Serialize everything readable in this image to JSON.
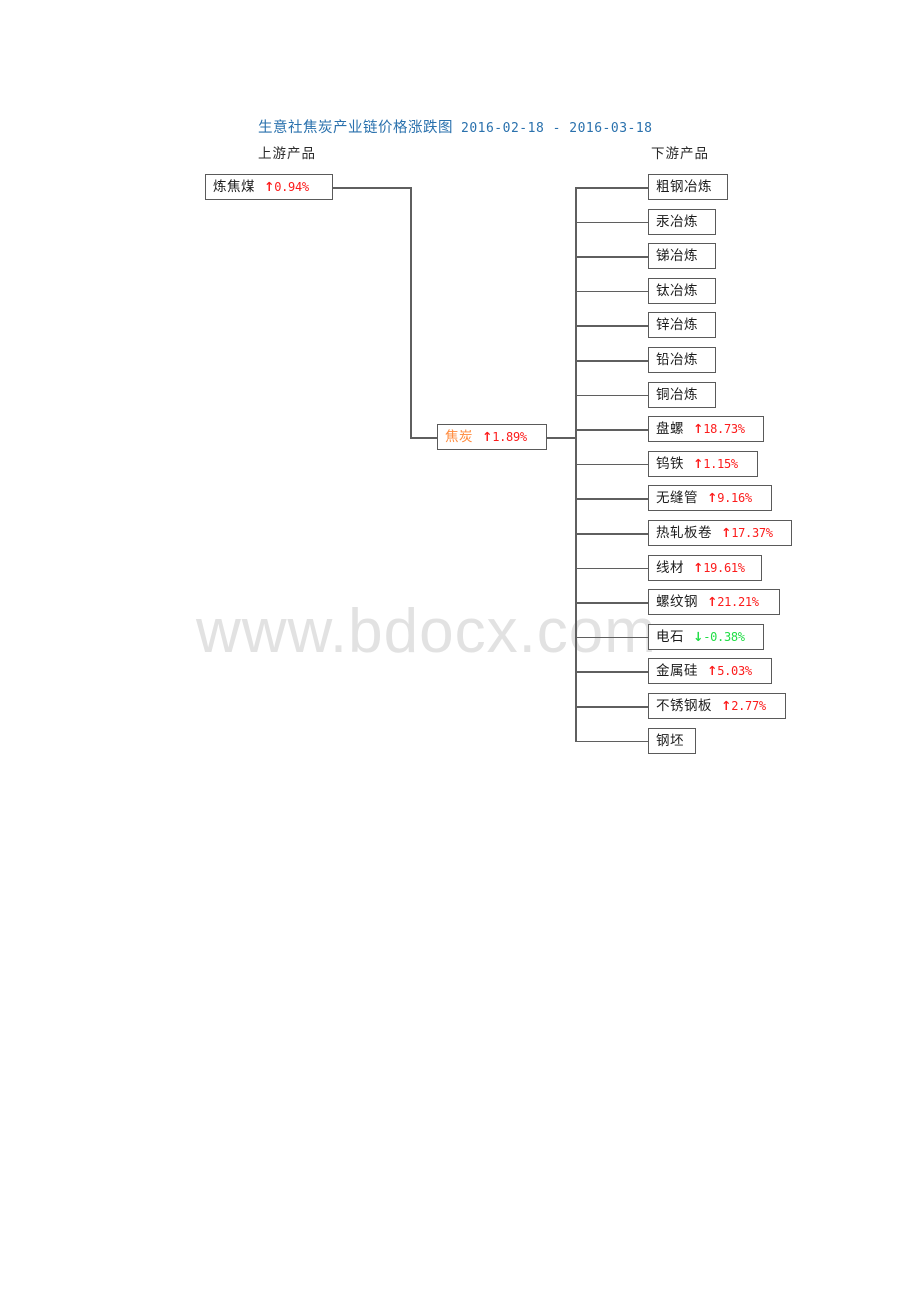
{
  "title": {
    "main": "生意社焦炭产业链价格涨跌图",
    "dates": "2016-02-18 - 2016-03-18",
    "color": "#2a71ad"
  },
  "headers": {
    "upstream": "上游产品",
    "downstream": "下游产品"
  },
  "watermark": "www.bdocx.com",
  "colors": {
    "up": "#fc1c1c",
    "down": "#20dd45",
    "center_name": "#ff8a3c",
    "box_border": "#5a5a5a",
    "line": "#5f5f5f",
    "watermark": "#e2e2e2"
  },
  "arrows": {
    "up": "↑",
    "down": "↓"
  },
  "upstream": [
    {
      "name": "炼焦煤",
      "arrow": "↑",
      "percent": "0.94%",
      "dir": "up"
    }
  ],
  "center": {
    "name": "焦炭",
    "arrow": "↑",
    "percent": "1.89%",
    "dir": "up"
  },
  "downstream": [
    {
      "name": "粗钢冶炼",
      "arrow": "",
      "percent": "",
      "dir": "none"
    },
    {
      "name": "汞冶炼",
      "arrow": "",
      "percent": "",
      "dir": "none"
    },
    {
      "name": "锑冶炼",
      "arrow": "",
      "percent": "",
      "dir": "none"
    },
    {
      "name": "钛冶炼",
      "arrow": "",
      "percent": "",
      "dir": "none"
    },
    {
      "name": "锌冶炼",
      "arrow": "",
      "percent": "",
      "dir": "none"
    },
    {
      "name": "铅冶炼",
      "arrow": "",
      "percent": "",
      "dir": "none"
    },
    {
      "name": "铜冶炼",
      "arrow": "",
      "percent": "",
      "dir": "none"
    },
    {
      "name": "盘螺",
      "arrow": "↑",
      "percent": "18.73%",
      "dir": "up"
    },
    {
      "name": "钨铁",
      "arrow": "↑",
      "percent": "1.15%",
      "dir": "up"
    },
    {
      "name": "无缝管",
      "arrow": "↑",
      "percent": "9.16%",
      "dir": "up"
    },
    {
      "name": "热轧板卷",
      "arrow": "↑",
      "percent": "17.37%",
      "dir": "up"
    },
    {
      "name": "线材",
      "arrow": "↑",
      "percent": "19.61%",
      "dir": "up"
    },
    {
      "name": "螺纹钢",
      "arrow": "↑",
      "percent": "21.21%",
      "dir": "up"
    },
    {
      "name": "电石",
      "arrow": "↓",
      "percent": "-0.38%",
      "dir": "down"
    },
    {
      "name": "金属硅",
      "arrow": "↑",
      "percent": "5.03%",
      "dir": "up"
    },
    {
      "name": "不锈钢板",
      "arrow": "↑",
      "percent": "2.77%",
      "dir": "up"
    },
    {
      "name": "钢坯",
      "arrow": "",
      "percent": "",
      "dir": "none"
    }
  ]
}
